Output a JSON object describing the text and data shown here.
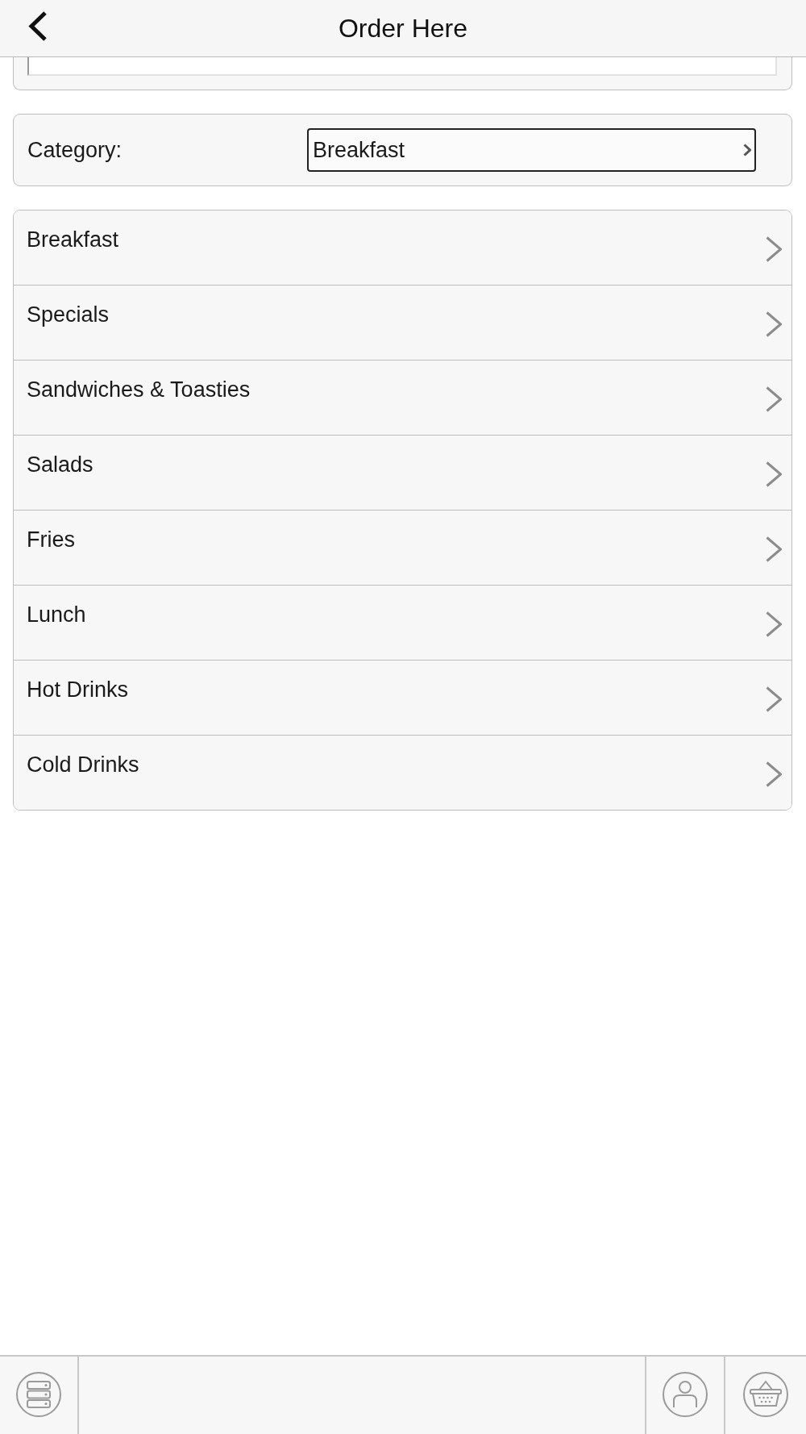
{
  "header": {
    "title": "Order Here"
  },
  "category": {
    "label": "Category:",
    "value": "Breakfast"
  },
  "menu": [
    {
      "label": "Breakfast"
    },
    {
      "label": "Specials"
    },
    {
      "label": "Sandwiches & Toasties"
    },
    {
      "label": "Salads"
    },
    {
      "label": "Fries"
    },
    {
      "label": "Lunch"
    },
    {
      "label": "Hot Drinks"
    },
    {
      "label": "Cold Drinks"
    }
  ]
}
